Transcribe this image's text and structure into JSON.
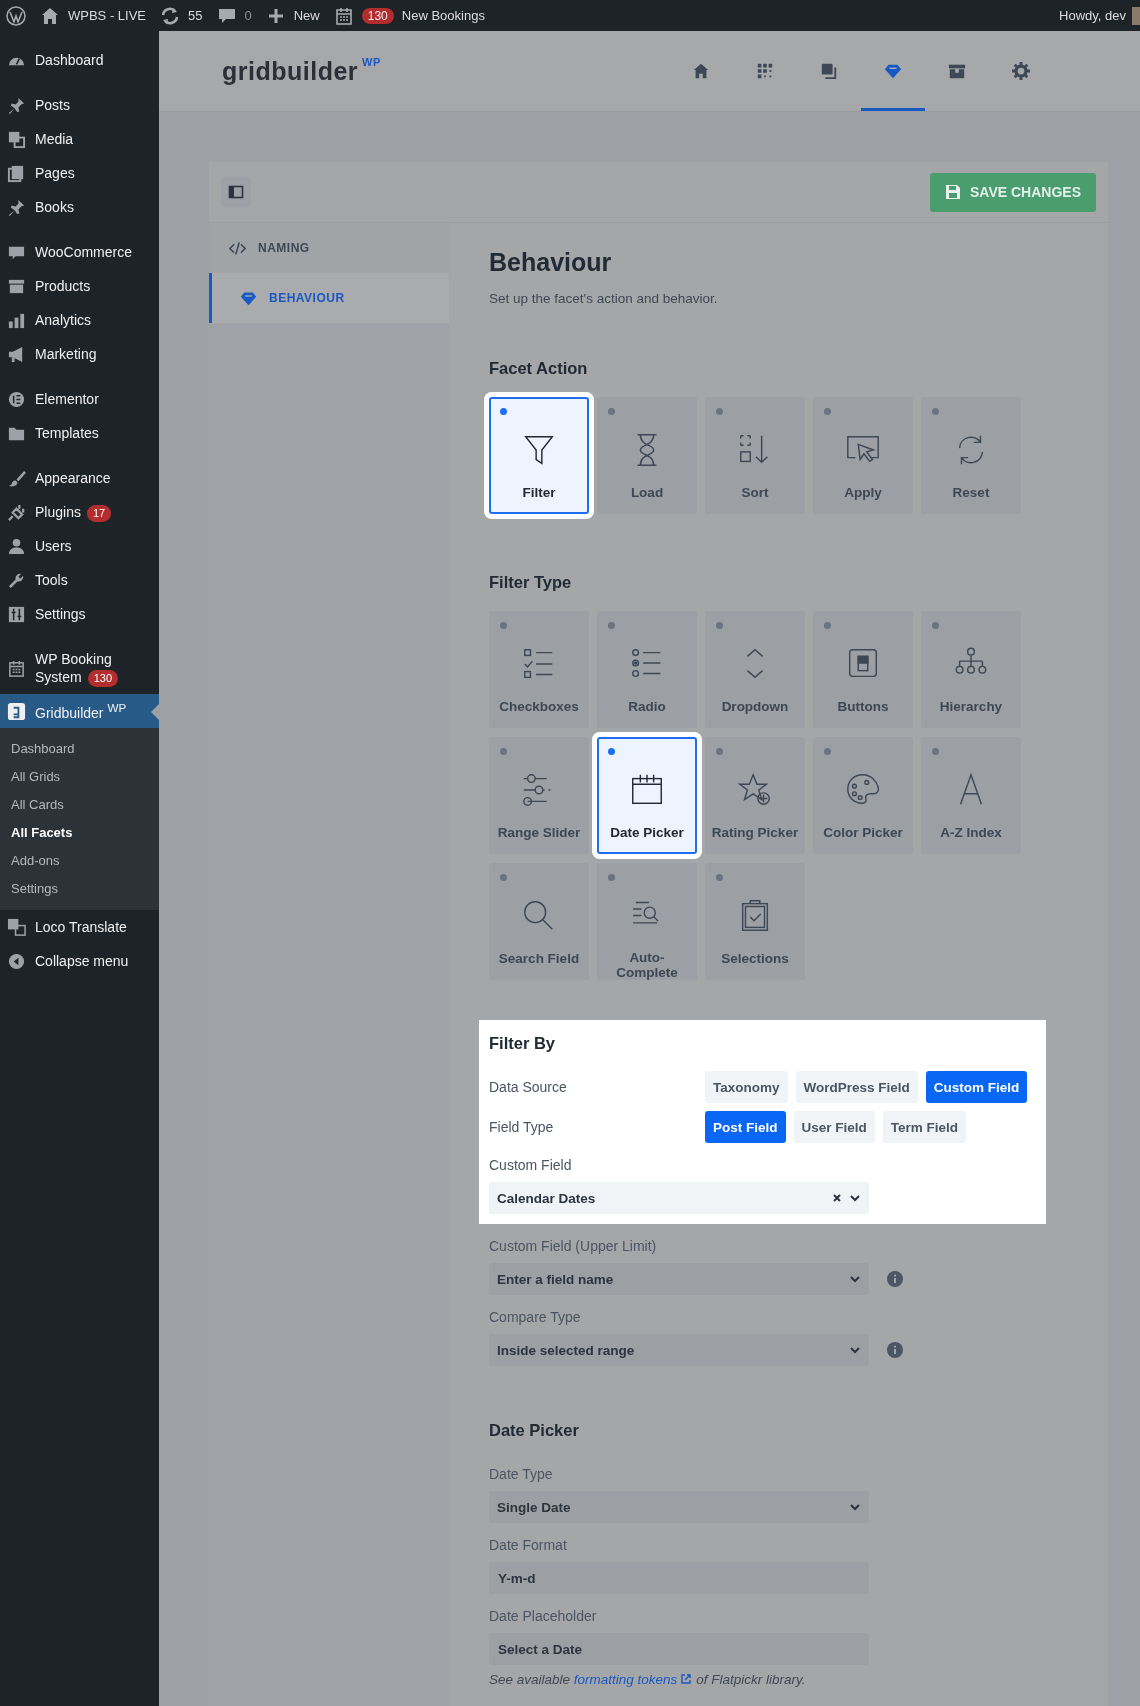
{
  "admin_bar": {
    "site": "WPBS - LIVE",
    "updates": "55",
    "comments": "0",
    "new": "New",
    "bookings_count": "130",
    "bookings": "New Bookings",
    "greeting": "Howdy, dev"
  },
  "sidebar": {
    "groups": [
      [
        {
          "label": "Dashboard",
          "selected": false
        }
      ],
      [
        {
          "label": "Posts",
          "selected": false
        },
        {
          "label": "Media",
          "selected": false
        },
        {
          "label": "Pages",
          "selected": false
        },
        {
          "label": "Books",
          "selected": false
        }
      ],
      [
        {
          "label": "WooCommerce",
          "selected": false
        },
        {
          "label": "Products",
          "selected": false
        },
        {
          "label": "Analytics",
          "selected": false
        },
        {
          "label": "Marketing",
          "selected": false
        }
      ],
      [
        {
          "label": "Elementor",
          "selected": false
        },
        {
          "label": "Templates",
          "selected": false
        }
      ],
      [
        {
          "label": "Appearance",
          "selected": false
        },
        {
          "label": "Plugins",
          "badge": "17",
          "selected": false
        },
        {
          "label": "Users",
          "selected": false
        },
        {
          "label": "Tools",
          "selected": false
        },
        {
          "label": "Settings",
          "selected": false
        }
      ],
      [
        {
          "label": "WP Booking System",
          "badge": "130",
          "selected": false
        },
        {
          "label": "Gridbuilder $^{WP}$",
          "selected": true,
          "children": [
            {
              "label": "Dashboard",
              "selected": false
            },
            {
              "label": "All Grids",
              "selected": false
            },
            {
              "label": "All Cards",
              "selected": false
            },
            {
              "label": "All Facets",
              "selected": true
            },
            {
              "label": "Add-ons",
              "selected": false
            },
            {
              "label": "Settings",
              "selected": false
            }
          ]
        },
        {
          "label": "Loco Translate",
          "selected": false
        },
        {
          "label": "Collapse menu",
          "selected": false
        }
      ]
    ]
  },
  "header": {
    "logo": "gridbuilder",
    "logo_sup": "WP",
    "nav": [
      {
        "selected": false
      },
      {
        "selected": false
      },
      {
        "selected": false
      },
      {
        "selected": true
      },
      {
        "selected": false
      },
      {
        "selected": false
      }
    ]
  },
  "toolbar": {
    "save": "SAVE CHANGES"
  },
  "panel_nav": [
    {
      "label": "NAMING",
      "selected": false
    },
    {
      "label": "BEHAVIOUR",
      "selected": true
    }
  ],
  "title": "Behaviour",
  "subtitle": "Set up the facet's action and behavior.",
  "facet_action": {
    "heading": "Facet Action",
    "options": [
      {
        "label": "Filter",
        "selected": true
      },
      {
        "label": "Load",
        "selected": false
      },
      {
        "label": "Sort",
        "selected": false
      },
      {
        "label": "Apply",
        "selected": false
      },
      {
        "label": "Reset",
        "selected": false
      }
    ]
  },
  "filter_type": {
    "heading": "Filter Type",
    "options": [
      {
        "label": "Checkboxes",
        "selected": false
      },
      {
        "label": "Radio",
        "selected": false
      },
      {
        "label": "Dropdown",
        "selected": false
      },
      {
        "label": "Buttons",
        "selected": false
      },
      {
        "label": "Hierarchy",
        "selected": false
      },
      {
        "label": "Range Slider",
        "selected": false
      },
      {
        "label": "Date Picker",
        "selected": true
      },
      {
        "label": "Rating Picker",
        "selected": false
      },
      {
        "label": "Color Picker",
        "selected": false
      },
      {
        "label": "A-Z Index",
        "selected": false
      },
      {
        "label": "Search Field",
        "selected": false
      },
      {
        "label": "Auto-Complete",
        "selected": false
      },
      {
        "label": "Selections",
        "selected": false
      }
    ]
  },
  "filter_by": {
    "heading": "Filter By",
    "highlighted": true,
    "choices": [
      {
        "label": "Data Source",
        "options": [
          {
            "label": "Taxonomy",
            "selected": false
          },
          {
            "label": "WordPress Field",
            "selected": false
          },
          {
            "label": "Custom Field",
            "selected": true
          }
        ]
      },
      {
        "label": "Field Type",
        "options": [
          {
            "label": "Post Field",
            "selected": true
          },
          {
            "label": "User Field",
            "selected": false
          },
          {
            "label": "Term Field",
            "selected": false
          }
        ]
      }
    ],
    "field": {
      "label": "Custom Field",
      "value": "Calendar Dates",
      "kind": "clearable"
    }
  },
  "filter_fields": [
    {
      "label": "Custom Field (Upper Limit)",
      "value": "Enter a field name",
      "kind": "select",
      "info": true
    },
    {
      "label": "Compare Type",
      "value": "Inside selected range",
      "kind": "select",
      "info": true
    }
  ],
  "date_picker": {
    "heading": "Date Picker",
    "fields": [
      {
        "label": "Date Type",
        "value": "Single Date",
        "kind": "select"
      },
      {
        "label": "Date Format",
        "value": "Y-m-d",
        "kind": "text"
      },
      {
        "label": "Date Placeholder",
        "value": "Select a Date",
        "kind": "text"
      }
    ],
    "help_before": "See available",
    "help_link": "formatting tokens",
    "help_after": "of Flatpickr library."
  }
}
